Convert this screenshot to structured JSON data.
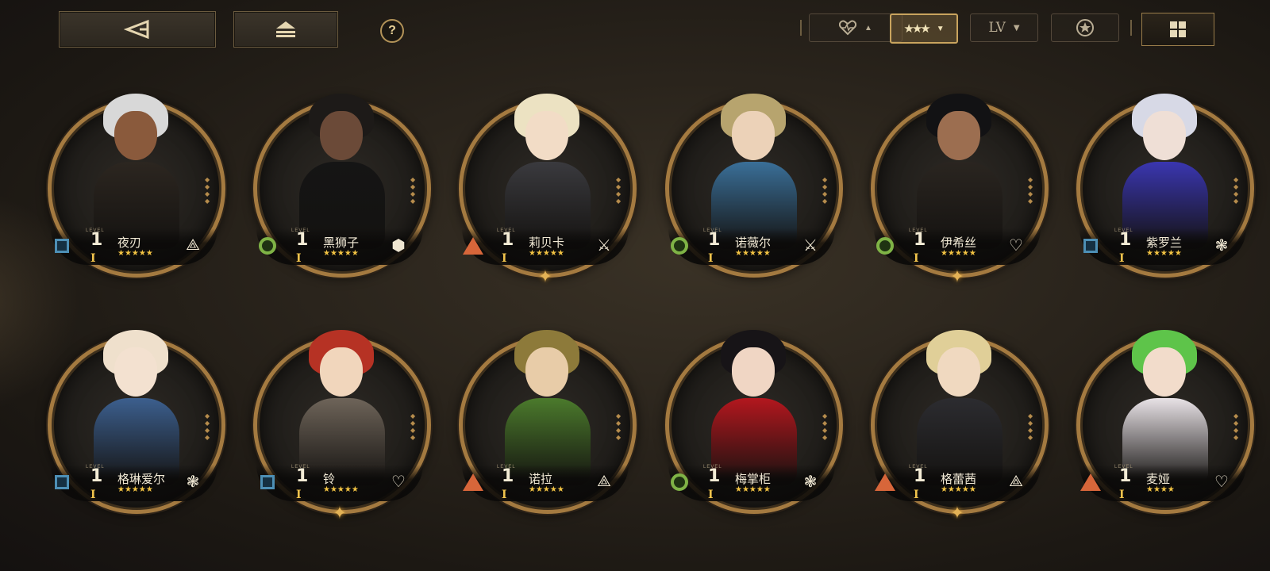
{
  "toolbar": {
    "back_icon": "back-triangle-icon",
    "collapse_icon": "eject-icon",
    "help_label": "?",
    "filters": [
      {
        "id": "favorite",
        "icon": "heart-icon",
        "caret": "▲",
        "active": false
      },
      {
        "id": "rarity",
        "icon": "stars-icon",
        "caret": "▼",
        "active": true
      },
      {
        "id": "level",
        "label": "LV",
        "caret": "▼",
        "active": false
      },
      {
        "id": "star",
        "icon": "star-circle-icon",
        "active": false
      }
    ],
    "grid_icon": "grid-view-icon"
  },
  "characters": [
    {
      "name": "夜刃",
      "level": "1",
      "rank": "I",
      "element": "square",
      "class_icon": "spike-icon",
      "stars": "★★★★★",
      "hair": "#d8d8d8",
      "skin": "#8a5a3c",
      "outfit": "#2c2620",
      "sparkle": false
    },
    {
      "name": "黑狮子",
      "level": "1",
      "rank": "I",
      "element": "circle",
      "class_icon": "hex-icon",
      "stars": "★★★★★",
      "hair": "#1d1a18",
      "skin": "#6b4a38",
      "outfit": "#151515",
      "sparkle": false
    },
    {
      "name": "莉贝卡",
      "level": "1",
      "rank": "I",
      "element": "triangle",
      "class_icon": "swords-icon",
      "stars": "★★★★★",
      "hair": "#ece2c2",
      "skin": "#f2dcc6",
      "outfit": "#3a3a3e",
      "sparkle": true
    },
    {
      "name": "诺薇尔",
      "level": "1",
      "rank": "I",
      "element": "circle",
      "class_icon": "swords-icon",
      "stars": "★★★★★",
      "hair": "#b7a46e",
      "skin": "#ecd2b8",
      "outfit": "#3a6f98",
      "sparkle": false
    },
    {
      "name": "伊希丝",
      "level": "1",
      "rank": "I",
      "element": "circle",
      "class_icon": "heart-icon",
      "stars": "★★★★★",
      "hair": "#121214",
      "skin": "#9c6e50",
      "outfit": "#2a2520",
      "sparkle": true
    },
    {
      "name": "紫罗兰",
      "level": "1",
      "rank": "I",
      "element": "square",
      "class_icon": "flower-icon",
      "stars": "★★★★★",
      "hair": "#d7d9e6",
      "skin": "#efdfd6",
      "outfit": "#3a36b0",
      "sparkle": false
    },
    {
      "name": "格琳爱尔",
      "level": "1",
      "rank": "I",
      "element": "square",
      "class_icon": "flower-icon",
      "stars": "★★★★★",
      "hair": "#efe0cc",
      "skin": "#f3e1d0",
      "outfit": "#3c5f8e",
      "sparkle": false
    },
    {
      "name": "铃",
      "level": "1",
      "rank": "I",
      "element": "square",
      "class_icon": "heart-icon",
      "stars": "★★★★★",
      "hair": "#b63224",
      "skin": "#f1d6bc",
      "outfit": "#6e6459",
      "sparkle": true
    },
    {
      "name": "诺拉",
      "level": "1",
      "rank": "I",
      "element": "triangle",
      "class_icon": "spike-icon",
      "stars": "★★★★★",
      "hair": "#8d7a3a",
      "skin": "#e8cca8",
      "outfit": "#4b7a2c",
      "sparkle": false
    },
    {
      "name": "梅掌柜",
      "level": "1",
      "rank": "I",
      "element": "circle",
      "class_icon": "flower-icon",
      "stars": "★★★★★",
      "hair": "#171417",
      "skin": "#f0d6c4",
      "outfit": "#b3171e",
      "sparkle": false
    },
    {
      "name": "格蕾茜",
      "level": "1",
      "rank": "I",
      "element": "triangle",
      "class_icon": "spike-icon",
      "stars": "★★★★★",
      "hair": "#e0cf98",
      "skin": "#f0d9c0",
      "outfit": "#2c2c30",
      "sparkle": true
    },
    {
      "name": "麦娅",
      "level": "1",
      "rank": "I",
      "element": "triangle",
      "class_icon": "heart-icon",
      "stars": "★★★★",
      "hair": "#5ec44a",
      "skin": "#f2dccb",
      "outfit": "#e8e2e6",
      "sparkle": false
    }
  ]
}
